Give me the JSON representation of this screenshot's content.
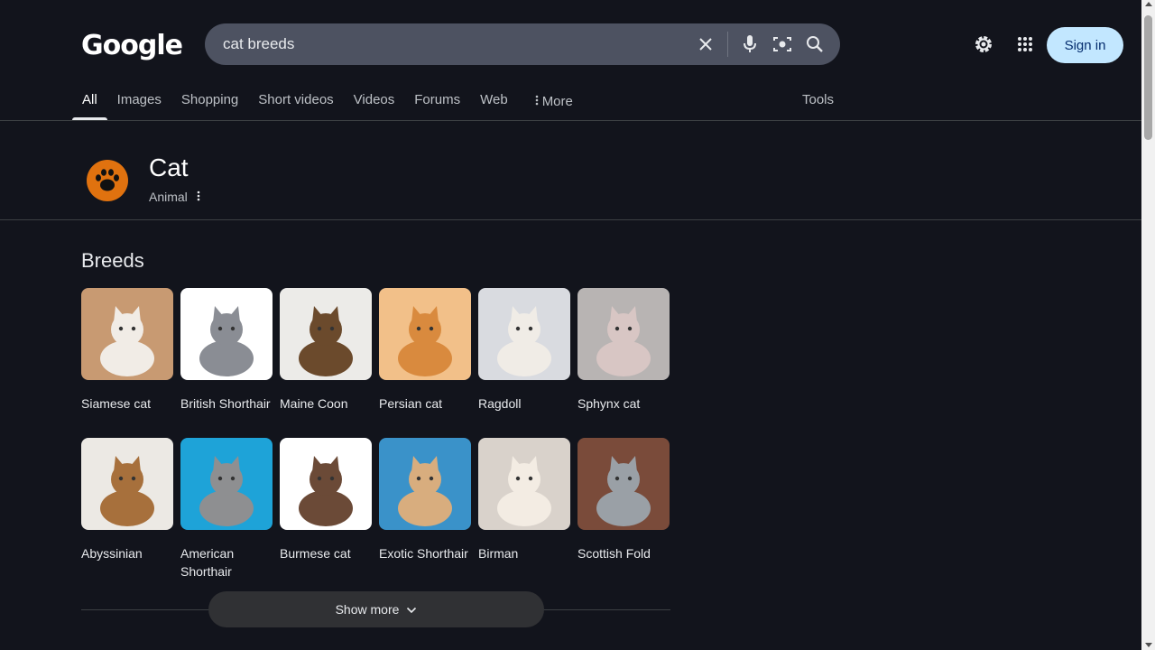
{
  "header": {
    "logo": "Google",
    "search_query": "cat breeds",
    "signin_label": "Sign in"
  },
  "tabs": [
    {
      "label": "All",
      "active": true
    },
    {
      "label": "Images"
    },
    {
      "label": "Shopping"
    },
    {
      "label": "Short videos"
    },
    {
      "label": "Videos"
    },
    {
      "label": "Forums"
    },
    {
      "label": "Web"
    },
    {
      "label": "More"
    }
  ],
  "tools_label": "Tools",
  "entity": {
    "title": "Cat",
    "subtitle": "Animal",
    "icon": "paw-icon",
    "icon_color": "#e0720f"
  },
  "breeds": {
    "heading": "Breeds",
    "row1": [
      {
        "name": "Siamese cat",
        "bg": "#c89a72",
        "cat": "#f1ece6"
      },
      {
        "name": "British Shorthair",
        "bg": "#ffffff",
        "cat": "#8a8d94"
      },
      {
        "name": "Maine Coon",
        "bg": "#ecebe8",
        "cat": "#6b4a2c"
      },
      {
        "name": "Persian cat",
        "bg": "#f2c089",
        "cat": "#d98a3e"
      },
      {
        "name": "Ragdoll",
        "bg": "#d9dbe0",
        "cat": "#f0ece6"
      },
      {
        "name": "Sphynx cat",
        "bg": "#b8b4b3",
        "cat": "#d8c6c4"
      }
    ],
    "row2": [
      {
        "name": "Abyssinian",
        "bg": "#ece9e4",
        "cat": "#a7703c"
      },
      {
        "name": "American Shorthair",
        "bg": "#1ea3d8",
        "cat": "#8e8f91"
      },
      {
        "name": "Burmese cat",
        "bg": "#ffffff",
        "cat": "#6b4a37"
      },
      {
        "name": "Exotic Shorthair",
        "bg": "#3a92c9",
        "cat": "#d8ad7e"
      },
      {
        "name": "Birman",
        "bg": "#d9d2cb",
        "cat": "#f3ece3"
      },
      {
        "name": "Scottish Fold",
        "bg": "#7a4b3a",
        "cat": "#9aa0a6"
      }
    ]
  },
  "show_more_label": "Show more"
}
